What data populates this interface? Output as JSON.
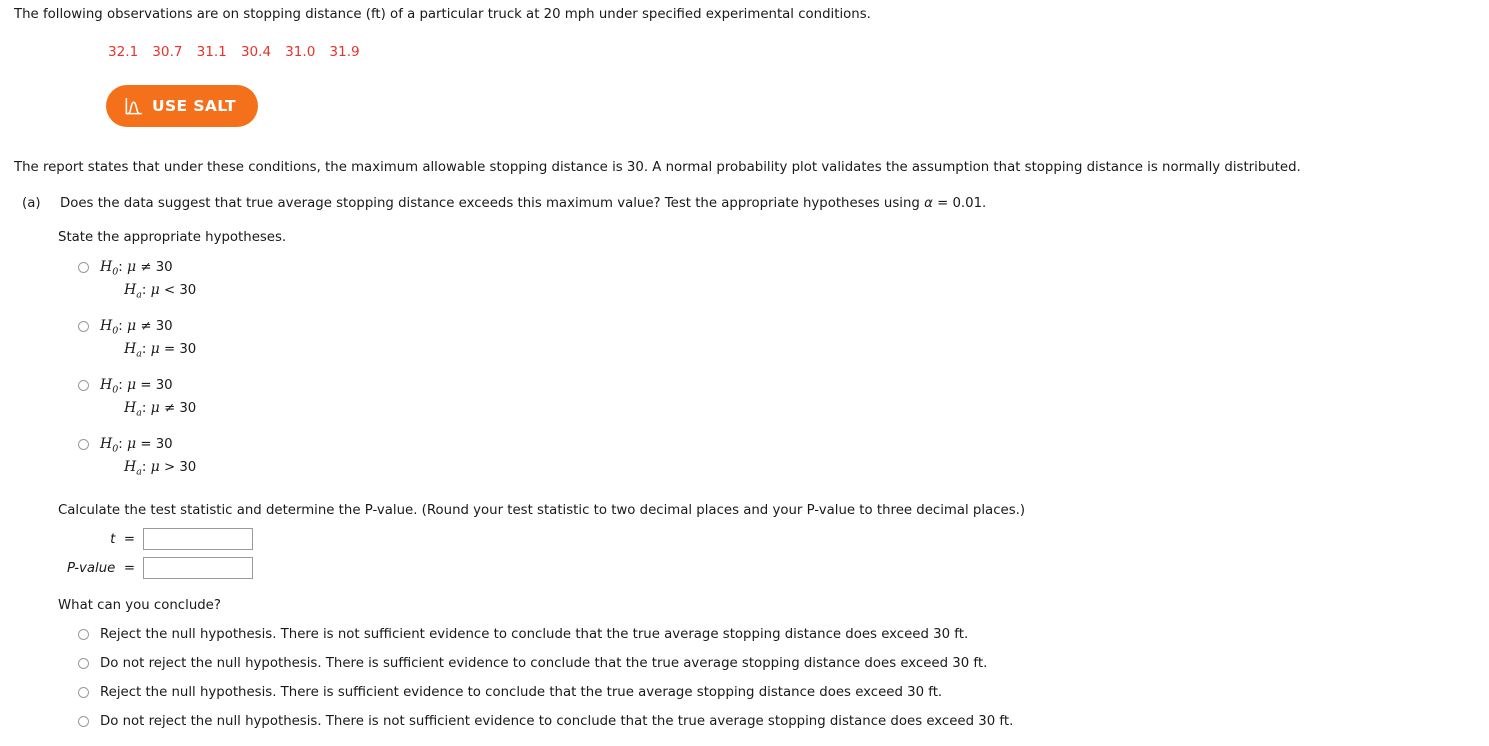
{
  "problem": {
    "intro": "The following observations are on stopping distance (ft) of a particular truck at 20 mph under specified experimental conditions.",
    "observations": [
      "32.1",
      "30.7",
      "31.1",
      "30.4",
      "31.0",
      "31.9"
    ],
    "observations_color": "#e8332a",
    "report_text": "The report states that under these conditions, the maximum allowable stopping distance is 30. A normal probability plot validates the assumption that stopping distance is normally distributed."
  },
  "salt_button": {
    "label": "USE SALT",
    "icon": "distribution-curve-icon",
    "background": "#f4701b",
    "text_color": "#ffffff"
  },
  "part_a": {
    "marker": "(a)",
    "question": "Does the data suggest that true average stopping distance exceeds this maximum value? Test the appropriate hypotheses using α = 0.01.",
    "question_pre": "Does the data suggest that true average stopping distance exceeds this maximum value? Test the appropriate hypotheses using ",
    "alpha_symbol": "α",
    "question_post": " = 0.01.",
    "hypotheses_prompt": "State the appropriate hypotheses.",
    "hypotheses_options": [
      {
        "null_symbol": "H",
        "null_sub": "0",
        "null_rel": "≠",
        "null_value": "30",
        "alt_symbol": "H",
        "alt_sub": "a",
        "alt_rel": "<",
        "alt_value": "30",
        "selected": false
      },
      {
        "null_symbol": "H",
        "null_sub": "0",
        "null_rel": "≠",
        "null_value": "30",
        "alt_symbol": "H",
        "alt_sub": "a",
        "alt_rel": "=",
        "alt_value": "30",
        "selected": false
      },
      {
        "null_symbol": "H",
        "null_sub": "0",
        "null_rel": "=",
        "null_value": "30",
        "alt_symbol": "H",
        "alt_sub": "a",
        "alt_rel": "≠",
        "alt_value": "30",
        "selected": false
      },
      {
        "null_symbol": "H",
        "null_sub": "0",
        "null_rel": "=",
        "null_value": "30",
        "alt_symbol": "H",
        "alt_sub": "a",
        "alt_rel": ">",
        "alt_value": "30",
        "selected": false
      }
    ],
    "mu_symbol": "μ",
    "colon": ":",
    "calc_instruction": "Calculate the test statistic and determine the P-value. (Round your test statistic to two decimal places and your P-value to three decimal places.)",
    "fields": [
      {
        "label": "t",
        "label_italic": true,
        "equals": "=",
        "value": "",
        "placeholder": ""
      },
      {
        "label": "P-value",
        "label_italic": true,
        "equals": "=",
        "value": "",
        "placeholder": ""
      }
    ],
    "conclusion_prompt": "What can you conclude?",
    "conclusion_options": [
      {
        "text": "Reject the null hypothesis. There is not sufficient evidence to conclude that the true average stopping distance does exceed 30 ft.",
        "selected": false
      },
      {
        "text": "Do not reject the null hypothesis. There is sufficient evidence to conclude that the true average stopping distance does exceed 30 ft.",
        "selected": false
      },
      {
        "text": "Reject the null hypothesis. There is sufficient evidence to conclude that the true average stopping distance does exceed 30 ft.",
        "selected": false
      },
      {
        "text": "Do not reject the null hypothesis. There is not sufficient evidence to conclude that the true average stopping distance does exceed 30 ft.",
        "selected": false
      }
    ]
  }
}
